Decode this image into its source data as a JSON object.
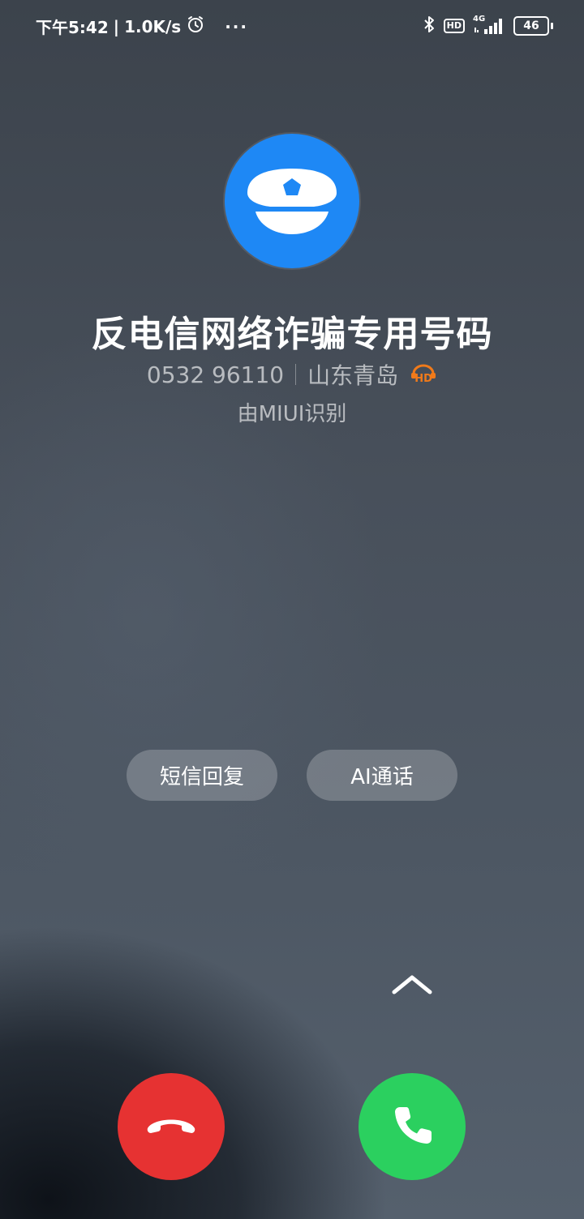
{
  "status_bar": {
    "time": "下午5:42",
    "separator": "|",
    "net_speed": "1.0K/s",
    "more": "···",
    "hd_badge": "HD",
    "network_type": "4G",
    "battery": "46",
    "icons": [
      "alarm-icon",
      "bluetooth-icon",
      "hd-voice-icon",
      "signal-icon",
      "battery-icon"
    ]
  },
  "caller": {
    "avatar_icon": "police-cap-icon",
    "name": "反电信网络诈骗专用号码",
    "number": "0532 96110",
    "location": "山东青岛",
    "hd_label": "HD",
    "identified_by": "由MIUI识别"
  },
  "actions": {
    "sms_reply": "短信回复",
    "ai_call": "AI通话"
  },
  "controls": {
    "decline_icon": "hang-up-icon",
    "accept_icon": "phone-icon",
    "swipe_hint_icon": "chevron-up-icon"
  },
  "colors": {
    "avatar_bg": "#1e88f5",
    "decline": "#e63232",
    "accept": "#2bd05f",
    "hd_orange": "#f07a1a"
  }
}
